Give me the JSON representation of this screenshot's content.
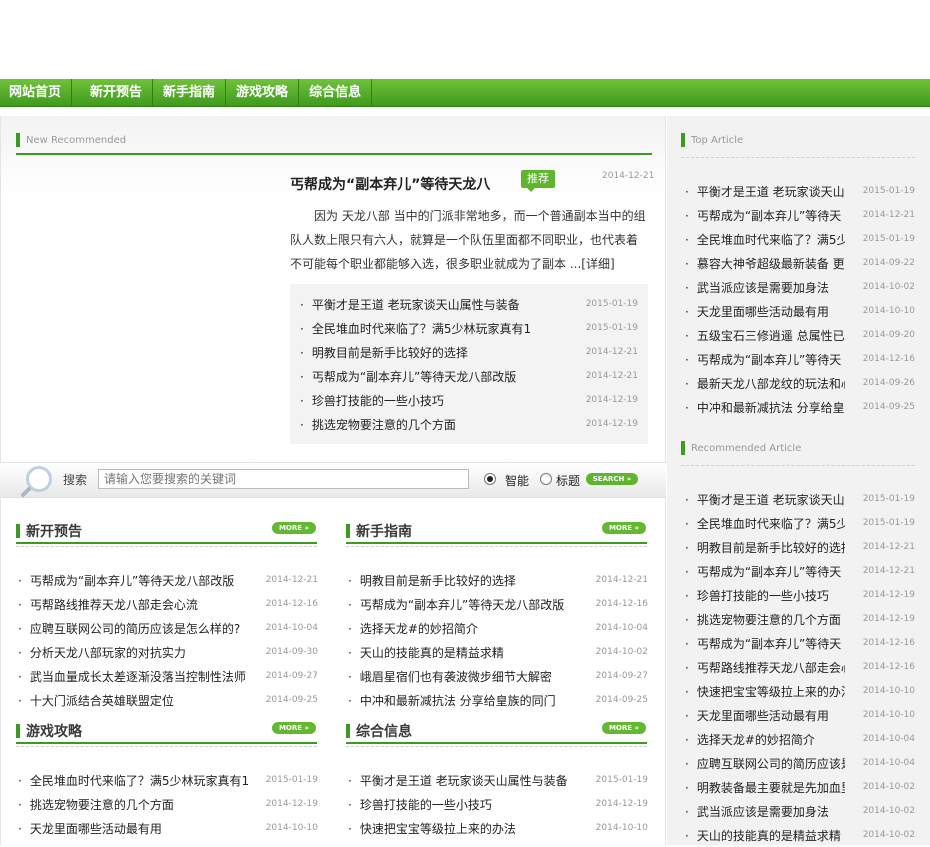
{
  "nav": [
    "网站首页",
    "新开预告",
    "新手指南",
    "游戏攻略",
    "综合信息"
  ],
  "new_recommended": {
    "heading": "New Recommended",
    "title": "丐帮成为“副本弃儿”等待天龙八",
    "tag": "推荐",
    "date": "2014-12-21",
    "desc": "因为 天龙八部 当中的门派非常地多，而一个普通副本当中的组队人数上限只有六人，就算是一个队伍里面都不同职业，也代表着不可能每个职业都能够入选，很多职业就成为了副本 ...",
    "detail": "[详细]",
    "items": [
      {
        "t": "平衡才是王道 老玩家谈天山属性与装备",
        "d": "2015-01-19"
      },
      {
        "t": "全民堆血时代来临了？满5少林玩家真有1",
        "d": "2015-01-19"
      },
      {
        "t": "明教目前是新手比较好的选择",
        "d": "2014-12-21"
      },
      {
        "t": "丐帮成为“副本弃儿”等待天龙八部改版",
        "d": "2014-12-21"
      },
      {
        "t": "珍兽打技能的一些小技巧",
        "d": "2014-12-19"
      },
      {
        "t": "挑选宠物要注意的几个方面",
        "d": "2014-12-19"
      }
    ]
  },
  "search": {
    "label": "搜索",
    "placeholder": "请输入您要搜索的关键词",
    "opt1": "智能",
    "opt2": "标题",
    "button": "SEARCH"
  },
  "more_label": "MORE",
  "cats": [
    {
      "title": "新开预告",
      "items": [
        {
          "t": "丐帮成为“副本弃儿”等待天龙八部改版",
          "d": "2014-12-21"
        },
        {
          "t": "丐帮路线推荐天龙八部走会心流",
          "d": "2014-12-16"
        },
        {
          "t": "应聘互联网公司的简历应该是怎么样的?",
          "d": "2014-10-04"
        },
        {
          "t": "分析天龙八部玩家的对抗实力",
          "d": "2014-09-30"
        },
        {
          "t": "武当血量成长太差逐渐没落当控制性法师",
          "d": "2014-09-27"
        },
        {
          "t": "十大门派结合英雄联盟定位",
          "d": "2014-09-25"
        }
      ]
    },
    {
      "title": "新手指南",
      "items": [
        {
          "t": "明教目前是新手比较好的选择",
          "d": "2014-12-21"
        },
        {
          "t": "丐帮成为“副本弃儿”等待天龙八部改版",
          "d": "2014-12-16"
        },
        {
          "t": "选择天龙#的妙招简介",
          "d": "2014-10-04"
        },
        {
          "t": "天山的技能真的是精益求精",
          "d": "2014-10-02"
        },
        {
          "t": "峨眉星宿们也有袭波微步细节大解密",
          "d": "2014-09-27"
        },
        {
          "t": "中冲和最新减抗法 分享给皇族的同门",
          "d": "2014-09-25"
        }
      ]
    },
    {
      "title": "游戏攻略",
      "items": [
        {
          "t": "全民堆血时代来临了？满5少林玩家真有1",
          "d": "2015-01-19"
        },
        {
          "t": "挑选宠物要注意的几个方面",
          "d": "2014-12-19"
        },
        {
          "t": "天龙里面哪些活动最有用",
          "d": "2014-10-10"
        }
      ]
    },
    {
      "title": "综合信息",
      "items": [
        {
          "t": "平衡才是王道 老玩家谈天山属性与装备",
          "d": "2015-01-19"
        },
        {
          "t": "珍兽打技能的一些小技巧",
          "d": "2014-12-19"
        },
        {
          "t": "快速把宝宝等级拉上来的办法",
          "d": "2014-10-10"
        }
      ]
    }
  ],
  "top_article": {
    "heading": "Top Article",
    "items": [
      {
        "t": "平衡才是王道 老玩家谈天山",
        "d": "2015-01-19"
      },
      {
        "t": "丐帮成为“副本弃儿”等待天",
        "d": "2014-12-21"
      },
      {
        "t": "全民堆血时代来临了？满5少",
        "d": "2015-01-19"
      },
      {
        "t": "慕容大神爷超级最新装备 更",
        "d": "2014-09-22"
      },
      {
        "t": "武当派应该是需要加身法",
        "d": "2014-10-02"
      },
      {
        "t": "天龙里面哪些活动最有用",
        "d": "2014-10-10"
      },
      {
        "t": "五级宝石三修逍遥 总属性已",
        "d": "2014-09-20"
      },
      {
        "t": "丐帮成为“副本弃儿”等待天",
        "d": "2014-12-16"
      },
      {
        "t": "最新天龙八部龙纹的玩法和心",
        "d": "2014-09-26"
      },
      {
        "t": "中冲和最新减抗法 分享给皇",
        "d": "2014-09-25"
      }
    ]
  },
  "recommended_article": {
    "heading": "Recommended Article",
    "items": [
      {
        "t": "平衡才是王道 老玩家谈天山",
        "d": "2015-01-19"
      },
      {
        "t": "全民堆血时代来临了？满5少",
        "d": "2015-01-19"
      },
      {
        "t": "明教目前是新手比较好的选择",
        "d": "2014-12-21"
      },
      {
        "t": "丐帮成为“副本弃儿”等待天",
        "d": "2014-12-21"
      },
      {
        "t": "珍兽打技能的一些小技巧",
        "d": "2014-12-19"
      },
      {
        "t": "挑选宠物要注意的几个方面",
        "d": "2014-12-19"
      },
      {
        "t": "丐帮成为“副本弃儿”等待天",
        "d": "2014-12-16"
      },
      {
        "t": "丐帮路线推荐天龙八部走会心",
        "d": "2014-12-16"
      },
      {
        "t": "快速把宝宝等级拉上来的办法",
        "d": "2014-10-10"
      },
      {
        "t": "天龙里面哪些活动最有用",
        "d": "2014-10-10"
      },
      {
        "t": "选择天龙#的妙招简介",
        "d": "2014-10-04"
      },
      {
        "t": "应聘互联网公司的简历应该是",
        "d": "2014-10-04"
      },
      {
        "t": "明教装备最主要就是先加血里",
        "d": "2014-10-02"
      },
      {
        "t": "武当派应该是需要加身法",
        "d": "2014-10-02"
      },
      {
        "t": "天山的技能真的是精益求精",
        "d": "2014-10-02"
      }
    ]
  }
}
